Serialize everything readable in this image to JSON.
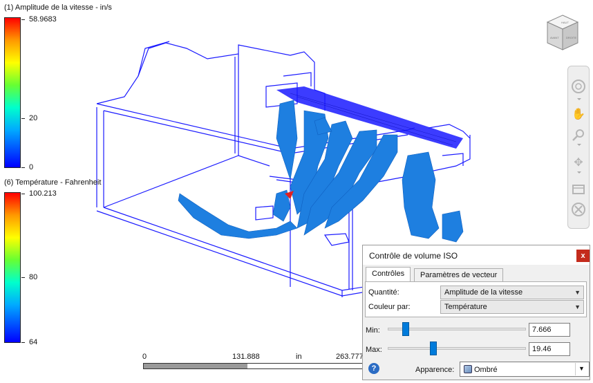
{
  "legend_velocity": {
    "title": "(1) Amplitude de la vitesse - in/s",
    "max": "58.9683",
    "mid": "20",
    "min": "0"
  },
  "legend_temperature": {
    "title": "(6) Température - Fahrenheit",
    "max": "100.213",
    "mid": "80",
    "min": "64"
  },
  "ruler": {
    "start": "0",
    "mid": "131.888",
    "unit": "in",
    "end": "263.777"
  },
  "viewcube": {
    "icon": "viewcube-icon"
  },
  "navbar": {
    "icons": [
      "steering-wheel-icon",
      "pan-hand-icon",
      "zoom-icon",
      "orbit-icon",
      "look-at-icon",
      "home-icon"
    ]
  },
  "iso_dialog": {
    "title": "Contrôle de volume ISO",
    "close": "x",
    "tabs": [
      {
        "label": "Contrôles",
        "active": true
      },
      {
        "label": "Paramètres de vecteur",
        "active": false
      }
    ],
    "quantity_label": "Quantité:",
    "quantity_value": "Amplitude de la vitesse",
    "color_label": "Couleur par:",
    "color_value": "Température",
    "min_label": "Min:",
    "min_value": "7.666",
    "min_slider_fraction": 0.13,
    "max_label": "Max:",
    "max_value": "19.46",
    "max_slider_fraction": 0.33,
    "help": "?",
    "appearance_label": "Apparence:",
    "appearance_value": "Ombré"
  },
  "colors": {
    "wireframe": "#1a1aff",
    "iso_surface": "#1e7fe0",
    "accent": "#007bdb"
  }
}
